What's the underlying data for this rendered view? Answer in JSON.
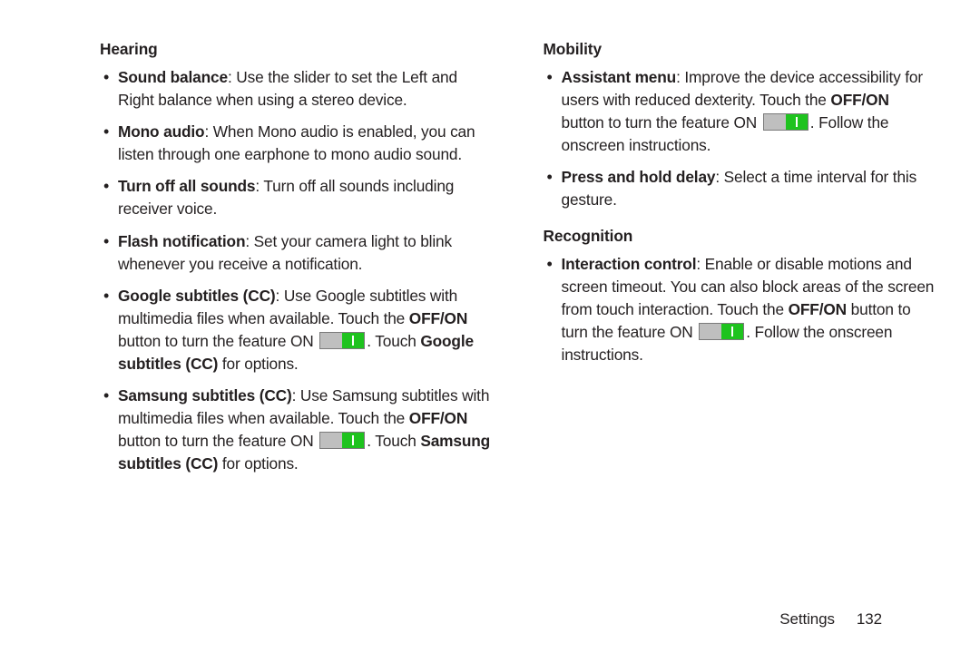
{
  "footer": {
    "section": "Settings",
    "page_number": "132"
  },
  "columns": {
    "left": {
      "sections": [
        {
          "heading": "Hearing",
          "items": [
            {
              "label": "Sound balance",
              "desc": ": Use the slider to set the Left and Right balance when using a stereo device."
            },
            {
              "label": "Mono audio",
              "desc": ": When Mono audio is enabled, you can listen through one earphone to mono audio sound."
            },
            {
              "label": "Turn off all sounds",
              "desc": ": Turn off all sounds including receiver voice."
            },
            {
              "label": "Flash notification",
              "desc": ": Set your camera light to blink whenever you receive a notification."
            },
            {
              "label": "Google subtitles (CC)",
              "desc_pre": ": Use Google subtitles with multimedia files when available. Touch the ",
              "offon": "OFF/ON",
              "desc_mid": " button to turn the feature ON ",
              "desc_after_toggle": ". Touch ",
              "bold_tail": "Google subtitles (CC)",
              "desc_end": " for options."
            },
            {
              "label": "Samsung subtitles (CC)",
              "desc_pre": ": Use Samsung subtitles with multimedia files when available. Touch the ",
              "offon": "OFF/ON",
              "desc_mid": " button to turn the feature ON ",
              "desc_after_toggle": ". Touch ",
              "bold_tail": "Samsung subtitles (CC)",
              "desc_end": " for options."
            }
          ]
        }
      ]
    },
    "right": {
      "sections": [
        {
          "heading": "Mobility",
          "items": [
            {
              "label": "Assistant menu",
              "desc_pre": ": Improve the device accessibility for users with reduced dexterity. Touch the ",
              "offon": "OFF/ON",
              "desc_mid": " button to turn the feature ON ",
              "desc_after_toggle": ". Follow the onscreen instructions."
            },
            {
              "label": "Press and hold delay",
              "desc": ": Select a time interval for this gesture."
            }
          ]
        },
        {
          "heading": "Recognition",
          "items": [
            {
              "label": "Interaction control",
              "desc_pre": ": Enable or disable motions and screen timeout. You can also block areas of the screen from touch interaction. Touch the ",
              "offon": "OFF/ON",
              "desc_mid": " button to turn the feature ON ",
              "desc_after_toggle": ". Follow the onscreen instructions."
            }
          ]
        }
      ]
    }
  }
}
